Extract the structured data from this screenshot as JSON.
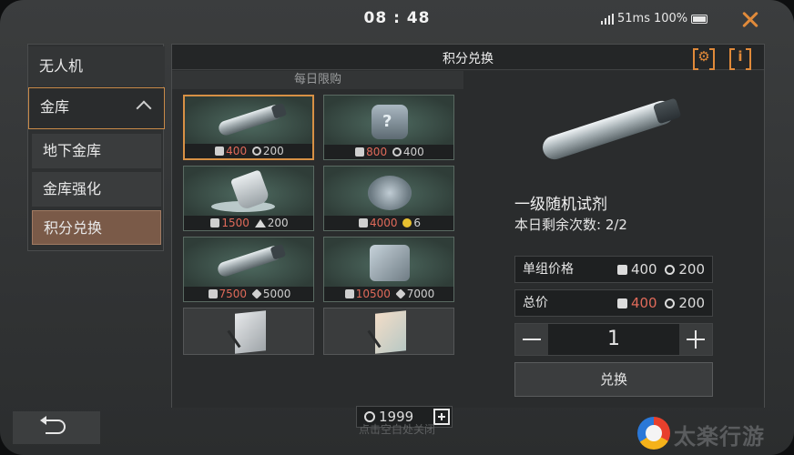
{
  "status": {
    "time": "08 : 48",
    "network": "51ms",
    "battery": "100%"
  },
  "sidebar": {
    "drone": "无人机",
    "vault": "金库",
    "sub": [
      "地下金库",
      "金库强化",
      "积分兑换"
    ]
  },
  "panel": {
    "title": "积分兑换",
    "daily_label": "每日限购"
  },
  "cards": [
    {
      "item": "serum-tube",
      "cost_a": "400",
      "cost_b": "200",
      "cost_b_icon": "coin-icon"
    },
    {
      "item": "mystery-safe",
      "cost_a": "800",
      "cost_b": "400",
      "cost_b_icon": "coin-icon"
    },
    {
      "item": "spilled-cup",
      "cost_a": "1500",
      "cost_b": "200",
      "cost_b_icon": "gold-icon"
    },
    {
      "item": "gear-chest",
      "cost_a": "4000",
      "cost_b": "6",
      "cost_b_icon": "star-icon"
    },
    {
      "item": "serum-tube",
      "cost_a": "7500",
      "cost_b": "5000",
      "cost_b_icon": "cube-icon"
    },
    {
      "item": "metal-safe",
      "cost_a": "10500",
      "cost_b": "7000",
      "cost_b_icon": "cube-icon"
    },
    {
      "item": "paper-sheet",
      "cost_a": "",
      "cost_b": "",
      "cost_b_icon": ""
    },
    {
      "item": "paper-sheet-orange",
      "cost_a": "",
      "cost_b": "",
      "cost_b_icon": ""
    }
  ],
  "currency": {
    "amount": "1999"
  },
  "detail": {
    "name": "一级随机试剂",
    "remaining": "本日剩余次数: 2/2",
    "unit_price_label": "单组价格",
    "unit_price_a": "400",
    "unit_price_b": "200",
    "total_label": "总价",
    "total_a": "400",
    "total_b": "200",
    "quantity": "1",
    "exchange_label": "兑换"
  },
  "footer": {
    "hint": "点击空白处关闭"
  },
  "watermark": {
    "text": "太楽行游"
  },
  "colors": {
    "accent": "#d79045",
    "price_red": "#e06a5a",
    "selected_tab": "#7a5a48"
  }
}
